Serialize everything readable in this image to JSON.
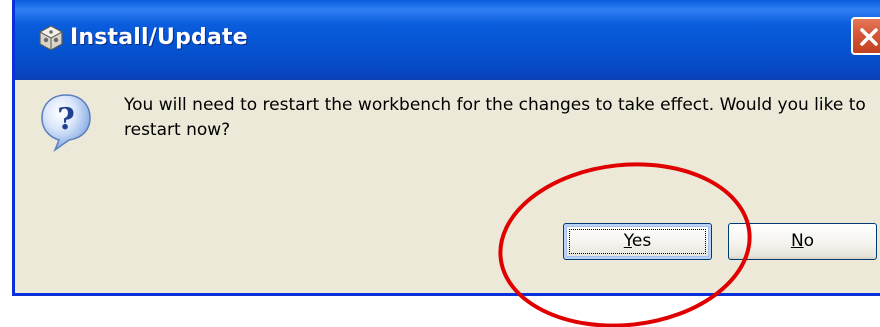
{
  "window": {
    "title": "Install/Update",
    "title_icon": "eclipse-update-icon",
    "close_icon": "close-icon"
  },
  "dialog": {
    "icon": "question-icon",
    "message": "You will need to restart the workbench for the changes to take effect. Would you like to restart now?",
    "buttons": {
      "yes": {
        "label_mnemonic": "Y",
        "label_rest": "es"
      },
      "no": {
        "label_mnemonic": "N",
        "label_rest": "o"
      }
    }
  },
  "annotation": {
    "shape": "ellipse",
    "color": "#e00000",
    "target": "yes-button"
  },
  "colors": {
    "titlebar": "#0553d0",
    "close_button": "#d65a3a",
    "dialog_background": "#ece9d8"
  }
}
